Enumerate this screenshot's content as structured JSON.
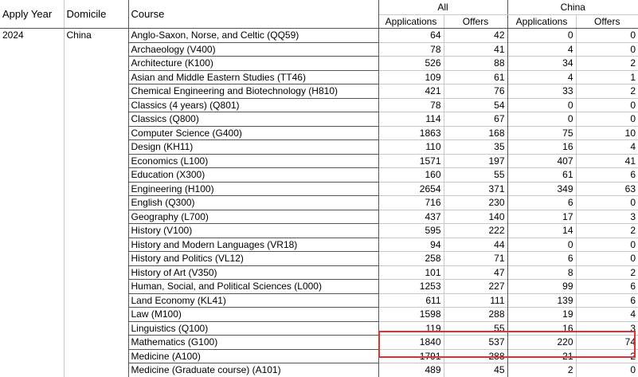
{
  "header": {
    "apply_year": "Apply Year",
    "domicile": "Domicile",
    "course": "Course",
    "group_all": "All",
    "group_china": "China",
    "applications": "Applications",
    "offers": "Offers"
  },
  "group": {
    "year": "2024",
    "domicile": "China"
  },
  "rows": [
    {
      "course": "Anglo-Saxon, Norse, and Celtic (QQ59)",
      "all_apps": "64",
      "all_offers": "42",
      "cn_apps": "0",
      "cn_offers": "0"
    },
    {
      "course": "Archaeology (V400)",
      "all_apps": "78",
      "all_offers": "41",
      "cn_apps": "4",
      "cn_offers": "0"
    },
    {
      "course": "Architecture (K100)",
      "all_apps": "526",
      "all_offers": "88",
      "cn_apps": "34",
      "cn_offers": "2"
    },
    {
      "course": "Asian and Middle Eastern Studies (TT46)",
      "all_apps": "109",
      "all_offers": "61",
      "cn_apps": "4",
      "cn_offers": "1"
    },
    {
      "course": "Chemical Engineering and Biotechnology (H810)",
      "all_apps": "421",
      "all_offers": "76",
      "cn_apps": "33",
      "cn_offers": "2"
    },
    {
      "course": "Classics (4 years) (Q801)",
      "all_apps": "78",
      "all_offers": "54",
      "cn_apps": "0",
      "cn_offers": "0"
    },
    {
      "course": "Classics (Q800)",
      "all_apps": "114",
      "all_offers": "67",
      "cn_apps": "0",
      "cn_offers": "0"
    },
    {
      "course": "Computer Science (G400)",
      "all_apps": "1863",
      "all_offers": "168",
      "cn_apps": "75",
      "cn_offers": "10"
    },
    {
      "course": "Design (KH11)",
      "all_apps": "110",
      "all_offers": "35",
      "cn_apps": "16",
      "cn_offers": "4"
    },
    {
      "course": "Economics (L100)",
      "all_apps": "1571",
      "all_offers": "197",
      "cn_apps": "407",
      "cn_offers": "41"
    },
    {
      "course": "Education (X300)",
      "all_apps": "160",
      "all_offers": "55",
      "cn_apps": "61",
      "cn_offers": "6"
    },
    {
      "course": "Engineering (H100)",
      "all_apps": "2654",
      "all_offers": "371",
      "cn_apps": "349",
      "cn_offers": "63"
    },
    {
      "course": "English (Q300)",
      "all_apps": "716",
      "all_offers": "230",
      "cn_apps": "6",
      "cn_offers": "0"
    },
    {
      "course": "Geography (L700)",
      "all_apps": "437",
      "all_offers": "140",
      "cn_apps": "17",
      "cn_offers": "3"
    },
    {
      "course": "History (V100)",
      "all_apps": "595",
      "all_offers": "222",
      "cn_apps": "14",
      "cn_offers": "2"
    },
    {
      "course": "History and Modern Languages (VR18)",
      "all_apps": "94",
      "all_offers": "44",
      "cn_apps": "0",
      "cn_offers": "0"
    },
    {
      "course": "History and Politics (VL12)",
      "all_apps": "258",
      "all_offers": "71",
      "cn_apps": "6",
      "cn_offers": "0"
    },
    {
      "course": "History of Art (V350)",
      "all_apps": "101",
      "all_offers": "47",
      "cn_apps": "8",
      "cn_offers": "2"
    },
    {
      "course": "Human, Social, and Political Sciences (L000)",
      "all_apps": "1253",
      "all_offers": "227",
      "cn_apps": "99",
      "cn_offers": "6"
    },
    {
      "course": "Land Economy (KL41)",
      "all_apps": "611",
      "all_offers": "111",
      "cn_apps": "139",
      "cn_offers": "6"
    },
    {
      "course": "Law (M100)",
      "all_apps": "1598",
      "all_offers": "288",
      "cn_apps": "19",
      "cn_offers": "4"
    },
    {
      "course": "Linguistics (Q100)",
      "all_apps": "119",
      "all_offers": "55",
      "cn_apps": "16",
      "cn_offers": "3"
    },
    {
      "course": "Mathematics (G100)",
      "all_apps": "1840",
      "all_offers": "537",
      "cn_apps": "220",
      "cn_offers": "74"
    },
    {
      "course": "Medicine (A100)",
      "all_apps": "1791",
      "all_offers": "288",
      "cn_apps": "21",
      "cn_offers": "2"
    },
    {
      "course": "Medicine (Graduate course) (A101)",
      "all_apps": "489",
      "all_offers": "45",
      "cn_apps": "2",
      "cn_offers": "0"
    }
  ],
  "colors": {
    "highlight": "#e03030",
    "grid": "#c8c8c8",
    "grid_dark": "#555555"
  }
}
